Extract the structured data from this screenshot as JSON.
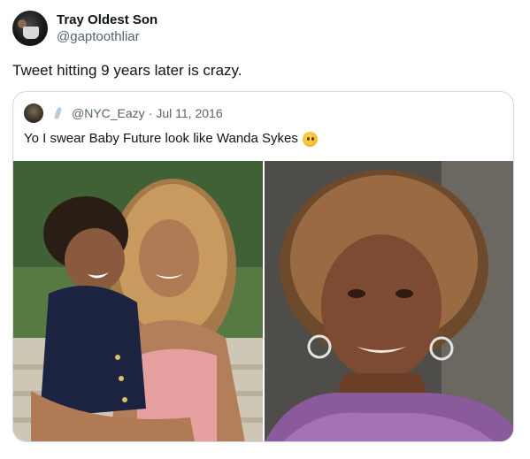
{
  "tweet": {
    "author": {
      "display_name": "Tray Oldest Son",
      "handle": "@gaptoothliar",
      "avatar_icon": "profile-avatar"
    },
    "text": "Tweet hitting 9 years later is crazy."
  },
  "quoted_tweet": {
    "avatar_icon": "profile-avatar",
    "badge_icon": "emoji-icon",
    "handle": "@NYC_Eazy",
    "separator": "·",
    "date": "Jul 11, 2016",
    "text": "Yo I swear Baby Future look like Wanda Sykes",
    "trailing_emoji_icon": "thinking-face-emoji",
    "media": [
      {
        "kind": "photo",
        "description_icon": "photo-woman-holding-child"
      },
      {
        "kind": "photo",
        "description_icon": "photo-woman-curly-hair"
      }
    ]
  },
  "colors": {
    "text_primary": "#0f1419",
    "text_secondary": "#536471",
    "border": "#cfd9de",
    "background": "#ffffff"
  }
}
